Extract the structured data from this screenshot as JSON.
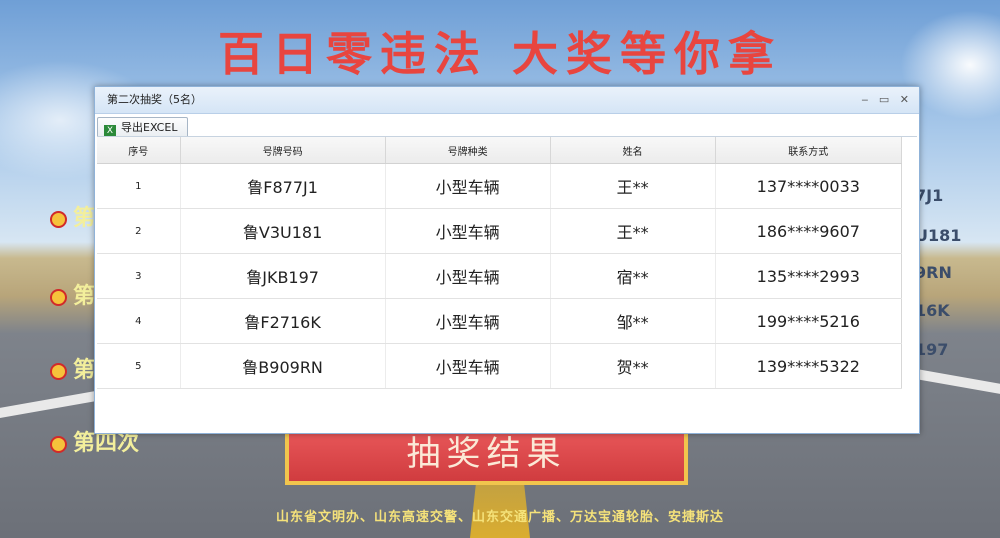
{
  "background": {
    "headline": "百日零违法  大奖等你拿",
    "rounds": [
      "第",
      "第",
      "第",
      "第四次"
    ],
    "side_plates": [
      "7J1",
      "U181",
      "9RN",
      "16K",
      "197"
    ],
    "result_button": "抽奖结果",
    "footer": "山东省文明办、山东高速交警、山东交通广播、万达宝通轮胎、安捷斯达"
  },
  "dialog": {
    "title": "第二次抽奖（5名）",
    "export_label": "导出EXCEL",
    "columns": [
      "序号",
      "号牌号码",
      "号牌种类",
      "姓名",
      "联系方式"
    ],
    "rows": [
      {
        "idx": "1",
        "plate": "鲁F877J1",
        "type": "小型车辆",
        "name": "王**",
        "phone": "137****0033"
      },
      {
        "idx": "2",
        "plate": "鲁V3U181",
        "type": "小型车辆",
        "name": "王**",
        "phone": "186****9607"
      },
      {
        "idx": "3",
        "plate": "鲁JKB197",
        "type": "小型车辆",
        "name": "宿**",
        "phone": "135****2993"
      },
      {
        "idx": "4",
        "plate": "鲁F2716K",
        "type": "小型车辆",
        "name": "邹**",
        "phone": "199****5216"
      },
      {
        "idx": "5",
        "plate": "鲁B909RN",
        "type": "小型车辆",
        "name": "贺**",
        "phone": "139****5322"
      }
    ]
  },
  "colors": {
    "headline": "#e8453f",
    "title_bar": "#d5e5f6",
    "result_button": "#d03c3f"
  }
}
